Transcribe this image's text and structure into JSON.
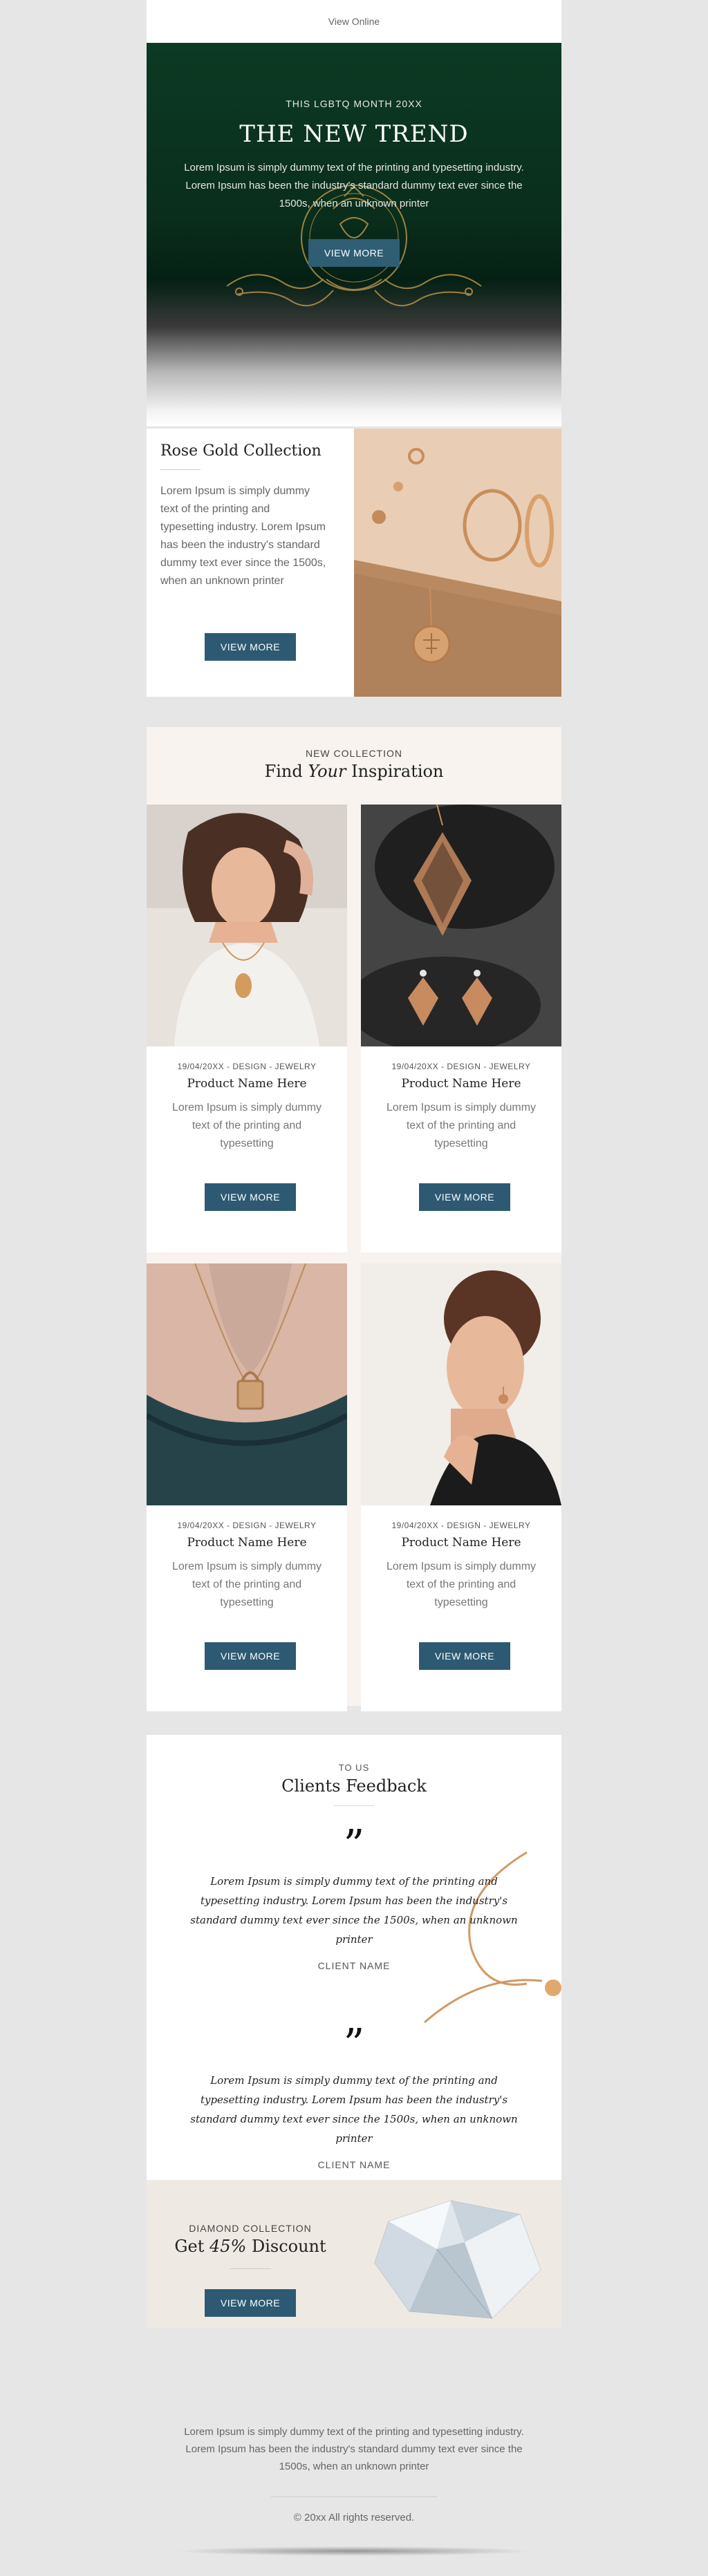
{
  "topbar": {
    "view_online": "View Online"
  },
  "hero": {
    "eyebrow": "THIS LGBTQ MONTH 20XX",
    "title": "THE NEW TREND",
    "body": "Lorem Ipsum is simply dummy text of the printing and typesetting industry. Lorem Ipsum has been the industry's standard dummy text ever since the 1500s, when an unknown printer",
    "button": "VIEW MORE"
  },
  "rose_gold": {
    "title": "Rose Gold Collection",
    "body": "Lorem Ipsum is simply dummy text of the printing and typesetting industry. Lorem Ipsum has been the industry's standard dummy text ever since the 1500s, when an unknown printer",
    "button": "VIEW MORE"
  },
  "collection": {
    "eyebrow": "NEW COLLECTION",
    "title_prefix": "Find ",
    "title_emphasis": "Your",
    "title_suffix": " Inspiration",
    "cards": [
      {
        "meta": "19/04/20XX - DESIGN - JEWELRY",
        "name": "Product Name Here",
        "body": "Lorem Ipsum is simply dummy text of the printing and typesetting",
        "button": "VIEW MORE"
      },
      {
        "meta": "19/04/20XX - DESIGN - JEWELRY",
        "name": "Product Name Here",
        "body": "Lorem Ipsum is simply dummy text of the printing and typesetting",
        "button": "VIEW MORE"
      },
      {
        "meta": "19/04/20XX - DESIGN - JEWELRY",
        "name": "Product Name Here",
        "body": "Lorem Ipsum is simply dummy text of the printing and typesetting",
        "button": "VIEW MORE"
      },
      {
        "meta": "19/04/20XX - DESIGN - JEWELRY",
        "name": "Product Name Here",
        "body": "Lorem Ipsum is simply dummy text of the printing and typesetting",
        "button": "VIEW MORE"
      }
    ]
  },
  "feedback": {
    "eyebrow": "TO US",
    "title": "Clients Feedback",
    "quotes": [
      {
        "mark": "”",
        "text": "Lorem Ipsum is simply dummy text of the printing and typesetting industry. Lorem Ipsum has been the industry's standard dummy text ever since the 1500s, when an unknown printer",
        "name": "CLIENT NAME"
      },
      {
        "mark": "”",
        "text": "Lorem Ipsum is simply dummy text of the printing and typesetting industry. Lorem Ipsum has been the industry's standard dummy text ever since the 1500s, when an unknown printer",
        "name": "CLIENT NAME"
      }
    ]
  },
  "discount": {
    "eyebrow": "DIAMOND COLLECTION",
    "title_prefix": "Get ",
    "title_emphasis": "45%",
    "title_suffix": " Discount",
    "button": "VIEW MORE"
  },
  "footer": {
    "body": "Lorem Ipsum is simply dummy text of the printing and typesetting industry. Lorem Ipsum has been the industry's standard dummy text ever since the 1500s, when an unknown printer",
    "copyright": "© 20xx All rights reserved."
  },
  "colors": {
    "button": "#2d5a72",
    "hero_green": "#0c3a24",
    "cream": "#f8f3ee",
    "page_bg": "#e6e6e6"
  }
}
